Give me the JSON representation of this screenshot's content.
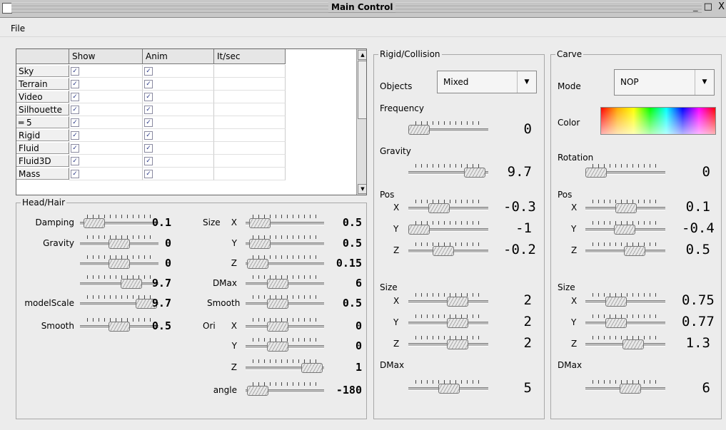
{
  "window": {
    "title": "Main Control",
    "controls": "_ □ X"
  },
  "menu": {
    "file": "File"
  },
  "table": {
    "headers": [
      "Show",
      "Anim",
      "It/sec"
    ],
    "rows": [
      {
        "label": "Sky",
        "show": true,
        "anim": true
      },
      {
        "label": "Terrain",
        "show": true,
        "anim": true
      },
      {
        "label": "Video",
        "show": true,
        "anim": true
      },
      {
        "label": "Silhouette",
        "show": true,
        "anim": true
      },
      {
        "label": "═ 5",
        "show": true,
        "anim": true
      },
      {
        "label": "Rigid",
        "show": true,
        "anim": true
      },
      {
        "label": "Fluid",
        "show": true,
        "anim": true
      },
      {
        "label": "Fluid3D",
        "show": true,
        "anim": true
      },
      {
        "label": "Mass",
        "show": true,
        "anim": true
      }
    ]
  },
  "head_hair": {
    "title": "Head/Hair",
    "left": [
      {
        "label": "Damping",
        "value": "0.1"
      },
      {
        "label": "Gravity",
        "value": "0"
      },
      {
        "label": "",
        "value": "0"
      },
      {
        "label": "",
        "value": "9.7"
      },
      {
        "label": "modelScale",
        "value": "9.7"
      },
      {
        "label": "Smooth",
        "value": "0.5"
      }
    ],
    "right": [
      {
        "group": "Size",
        "axis": "X",
        "value": "0.5"
      },
      {
        "group": "",
        "axis": "Y",
        "value": "0.5"
      },
      {
        "group": "",
        "axis": "Z",
        "value": "0.15"
      },
      {
        "group": "",
        "axis": "DMax",
        "value": "6"
      },
      {
        "group": "",
        "axis": "Smooth",
        "value": "0.5"
      },
      {
        "group": "Ori",
        "axis": "X",
        "value": "0"
      },
      {
        "group": "",
        "axis": "Y",
        "value": "0"
      },
      {
        "group": "",
        "axis": "Z",
        "value": "1"
      },
      {
        "group": "",
        "axis": "angle",
        "value": "-180"
      }
    ]
  },
  "rigid": {
    "title": "Rigid/Collision",
    "objects_label": "Objects",
    "objects_value": "Mixed",
    "frequency_label": "Frequency",
    "frequency_value": "0",
    "gravity_label": "Gravity",
    "gravity_value": "9.7",
    "pos_label": "Pos",
    "pos": [
      {
        "axis": "X",
        "value": "-0.3"
      },
      {
        "axis": "Y",
        "value": "-1"
      },
      {
        "axis": "Z",
        "value": "-0.2"
      }
    ],
    "size_label": "Size",
    "size": [
      {
        "axis": "X",
        "value": "2"
      },
      {
        "axis": "Y",
        "value": "2"
      },
      {
        "axis": "Z",
        "value": "2"
      }
    ],
    "dmax_label": "DMax",
    "dmax_value": "5"
  },
  "carve": {
    "title": "Carve",
    "mode_label": "Mode",
    "mode_value": "NOP",
    "color_label": "Color",
    "rotation_label": "Rotation",
    "rotation_value": "0",
    "pos_label": "Pos",
    "pos": [
      {
        "axis": "X",
        "value": "0.1"
      },
      {
        "axis": "Y",
        "value": "-0.4"
      },
      {
        "axis": "Z",
        "value": "0.5"
      }
    ],
    "size_label": "Size",
    "size": [
      {
        "axis": "X",
        "value": "0.75"
      },
      {
        "axis": "Y",
        "value": "0.77"
      },
      {
        "axis": "Z",
        "value": "1.3"
      }
    ],
    "dmax_label": "DMax",
    "dmax_value": "6"
  }
}
